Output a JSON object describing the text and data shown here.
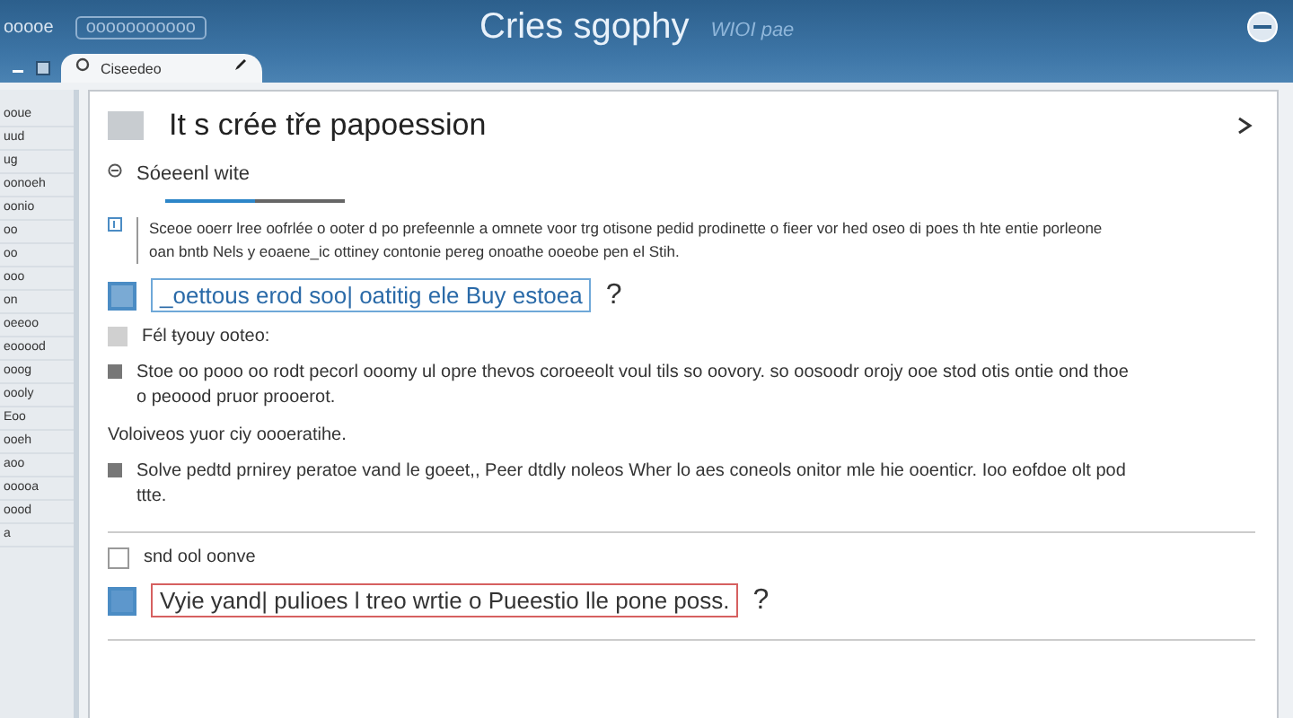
{
  "app": {
    "menu_label": "ooooe",
    "badge": "ooooooooooo",
    "title": "Cries sgophy",
    "subtitle": "WIOI pae"
  },
  "tab": {
    "label": "Ciseedeo",
    "selected": true
  },
  "sidebar": {
    "items": [
      {
        "label": "ooue"
      },
      {
        "label": "uud"
      },
      {
        "label": "ug"
      },
      {
        "label": "oonoeh"
      },
      {
        "label": "oonio"
      },
      {
        "label": "oo"
      },
      {
        "label": "oo"
      },
      {
        "label": "ooo"
      },
      {
        "label": "on"
      },
      {
        "label": "oeeoo"
      },
      {
        "label": "eooood"
      },
      {
        "label": "ooog"
      },
      {
        "label": "oooly"
      },
      {
        "label": "Eoo"
      },
      {
        "label": "ooeh"
      },
      {
        "label": "aoo"
      },
      {
        "label": "ooooa"
      },
      {
        "label": "oood"
      },
      {
        "label": "a"
      }
    ]
  },
  "panel": {
    "title": "It s crée tře papoession"
  },
  "blocks": [
    {
      "kind": "heading",
      "text": "Sóeeenl wite",
      "expanded": true
    },
    {
      "kind": "progress",
      "level": 0.5
    },
    {
      "kind": "paragraph",
      "text": "Sceoe ooerr lree oofrlée o ooter d po prefeennle a omnete voor trg otisone pedid prodinette o fieer vor hed oseo di poes th hte entie porleone oan bntb Nels y eoaene_ic ottiney contonie pereg onoathe ooeobe pen el Stih."
    },
    {
      "kind": "question",
      "invalid": false,
      "text": "_oettous erod soo| oatitig ele Buy estoea",
      "mark": "?"
    },
    {
      "kind": "label",
      "text": "Fél ŧyouy ooteo:"
    },
    {
      "kind": "bullet",
      "text": "Stoe oo pooo oo rodt pecorl ooomy ul opre thevos coroeeolt voul tils so oovory. so oosoodr orojy ooe stod otis ontie ond thoe o peoood pruor prooerot."
    },
    {
      "kind": "plain",
      "text": "Voloiveos yuor ciy oooeratihe."
    },
    {
      "kind": "bullet",
      "text": "Solve pedtd prnirey peratoe vand le goeet,, Peer dtdly noleos Wher lo aes coneols onitor mle hie ooenticr. Ioo eofdoe olt pod ttte."
    },
    {
      "kind": "rule"
    },
    {
      "kind": "check",
      "text": "snd ool oonve",
      "checked": false
    },
    {
      "kind": "question",
      "invalid": true,
      "text": "Vyie yand| pulioes l treo wrtie o Pueestio lle pone poss.",
      "mark": "?"
    },
    {
      "kind": "rule"
    }
  ]
}
